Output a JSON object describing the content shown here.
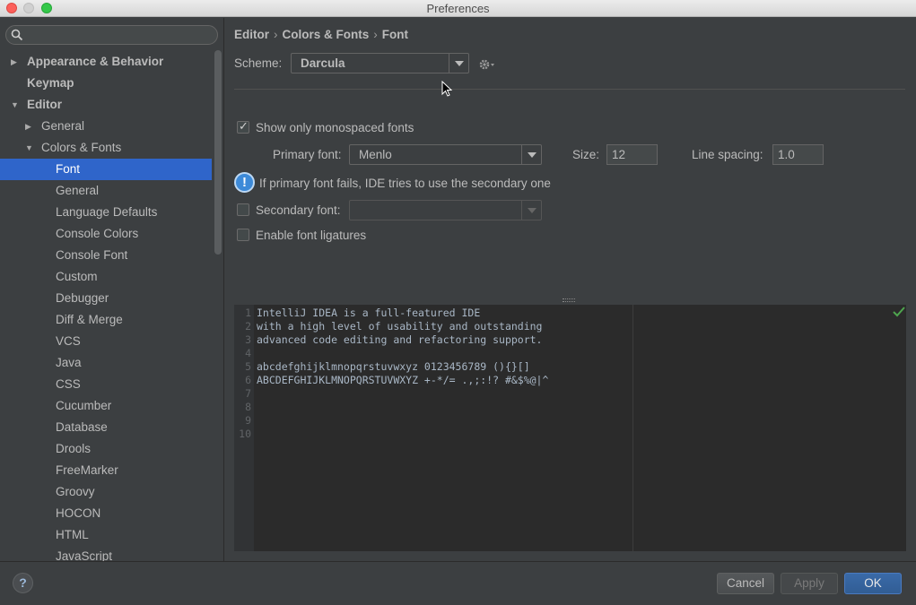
{
  "window": {
    "title": "Preferences"
  },
  "search": {
    "placeholder": ""
  },
  "tree": [
    {
      "label": "Appearance & Behavior",
      "bold": true,
      "arrow": "right",
      "level": 0
    },
    {
      "label": "Keymap",
      "bold": true,
      "arrow": "",
      "level": 0
    },
    {
      "label": "Editor",
      "bold": true,
      "arrow": "down",
      "level": 0
    },
    {
      "label": "General",
      "bold": false,
      "arrow": "right",
      "level": 1
    },
    {
      "label": "Colors & Fonts",
      "bold": false,
      "arrow": "down",
      "level": 1
    },
    {
      "label": "Font",
      "bold": false,
      "arrow": "",
      "level": 2,
      "selected": true
    },
    {
      "label": "General",
      "bold": false,
      "arrow": "",
      "level": 2
    },
    {
      "label": "Language Defaults",
      "bold": false,
      "arrow": "",
      "level": 2
    },
    {
      "label": "Console Colors",
      "bold": false,
      "arrow": "",
      "level": 2
    },
    {
      "label": "Console Font",
      "bold": false,
      "arrow": "",
      "level": 2
    },
    {
      "label": "Custom",
      "bold": false,
      "arrow": "",
      "level": 2
    },
    {
      "label": "Debugger",
      "bold": false,
      "arrow": "",
      "level": 2
    },
    {
      "label": "Diff & Merge",
      "bold": false,
      "arrow": "",
      "level": 2
    },
    {
      "label": "VCS",
      "bold": false,
      "arrow": "",
      "level": 2
    },
    {
      "label": "Java",
      "bold": false,
      "arrow": "",
      "level": 2
    },
    {
      "label": "CSS",
      "bold": false,
      "arrow": "",
      "level": 2
    },
    {
      "label": "Cucumber",
      "bold": false,
      "arrow": "",
      "level": 2
    },
    {
      "label": "Database",
      "bold": false,
      "arrow": "",
      "level": 2
    },
    {
      "label": "Drools",
      "bold": false,
      "arrow": "",
      "level": 2
    },
    {
      "label": "FreeMarker",
      "bold": false,
      "arrow": "",
      "level": 2
    },
    {
      "label": "Groovy",
      "bold": false,
      "arrow": "",
      "level": 2
    },
    {
      "label": "HOCON",
      "bold": false,
      "arrow": "",
      "level": 2
    },
    {
      "label": "HTML",
      "bold": false,
      "arrow": "",
      "level": 2
    },
    {
      "label": "JavaScript",
      "bold": false,
      "arrow": "",
      "level": 2
    }
  ],
  "breadcrumb": {
    "parts": [
      "Editor",
      "Colors & Fonts",
      "Font"
    ]
  },
  "scheme": {
    "label": "Scheme:",
    "value": "Darcula"
  },
  "options": {
    "monospaced_label": "Show only monospaced fonts",
    "monospaced_checked": true,
    "primary_font_label": "Primary font:",
    "primary_font_value": "Menlo",
    "size_label": "Size:",
    "size_value": "12",
    "line_spacing_label": "Line spacing:",
    "line_spacing_value": "1.0",
    "info_text": "If primary font fails, IDE tries to use the secondary one",
    "secondary_font_label": "Secondary font:",
    "secondary_font_checked": false,
    "ligatures_label": "Enable font ligatures",
    "ligatures_checked": false
  },
  "preview": {
    "lines": [
      {
        "num": "1",
        "text": "IntelliJ IDEA is a full-featured IDE"
      },
      {
        "num": "2",
        "text": "with a high level of usability and outstanding"
      },
      {
        "num": "3",
        "text": "advanced code editing and refactoring support."
      },
      {
        "num": "4",
        "text": ""
      },
      {
        "num": "5",
        "text": "abcdefghijklmnopqrstuvwxyz 0123456789 (){}[]"
      },
      {
        "num": "6",
        "text": "ABCDEFGHIJKLMNOPQRSTUVWXYZ +-*/= .,;:!? #&$%@|^"
      },
      {
        "num": "7",
        "text": ""
      },
      {
        "num": "8",
        "text": ""
      },
      {
        "num": "9",
        "text": ""
      },
      {
        "num": "10",
        "text": ""
      }
    ]
  },
  "buttons": {
    "help": "?",
    "cancel": "Cancel",
    "apply": "Apply",
    "ok": "OK"
  },
  "colors": {
    "selection": "#2f65ca",
    "background": "#3c3f41",
    "editor_bg": "#2b2b2b",
    "primary_button": "#3a6aa8"
  }
}
